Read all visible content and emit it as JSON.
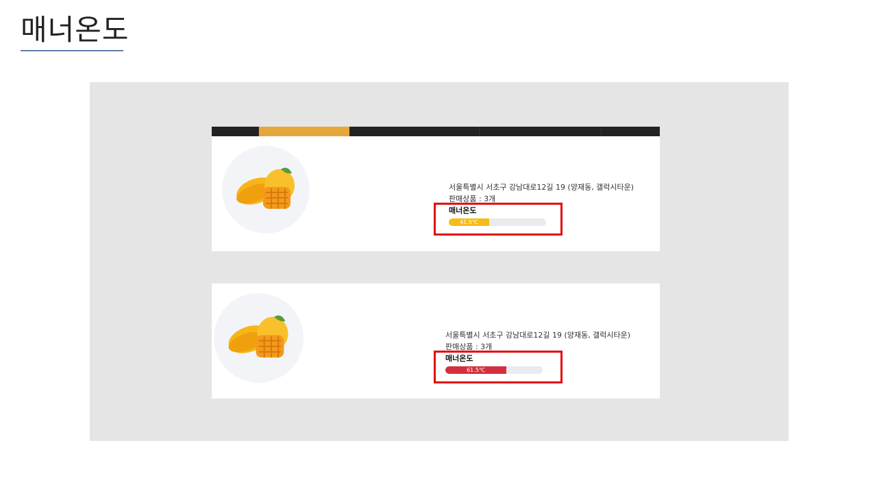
{
  "page": {
    "title": "매너온도"
  },
  "tabs": [
    "",
    "",
    "",
    "",
    ""
  ],
  "cards": [
    {
      "image_icon": "mango-icon",
      "address": "서울특별시 서초구 강남대로12길 19 (양재동, 갤럭시타운)",
      "product_count": "판매상품 : 3개",
      "manner_label": "매너온도",
      "temperature_text": "41.5℃",
      "temperature_value": 41.5,
      "bar_color": "#f5bd19"
    },
    {
      "image_icon": "mango-icon",
      "address": "서울특별시 서초구 강남대로12길 19 (양재동, 갤럭시타운)",
      "product_count": "판매상품 : 3개",
      "manner_label": "매너온도",
      "temperature_text": "61.5℃",
      "temperature_value": 61.5,
      "bar_color": "#d23040"
    }
  ],
  "colors": {
    "accent_tab": "#e5a73c",
    "highlight": "#e1080b",
    "underline": "#5f7fa8"
  }
}
